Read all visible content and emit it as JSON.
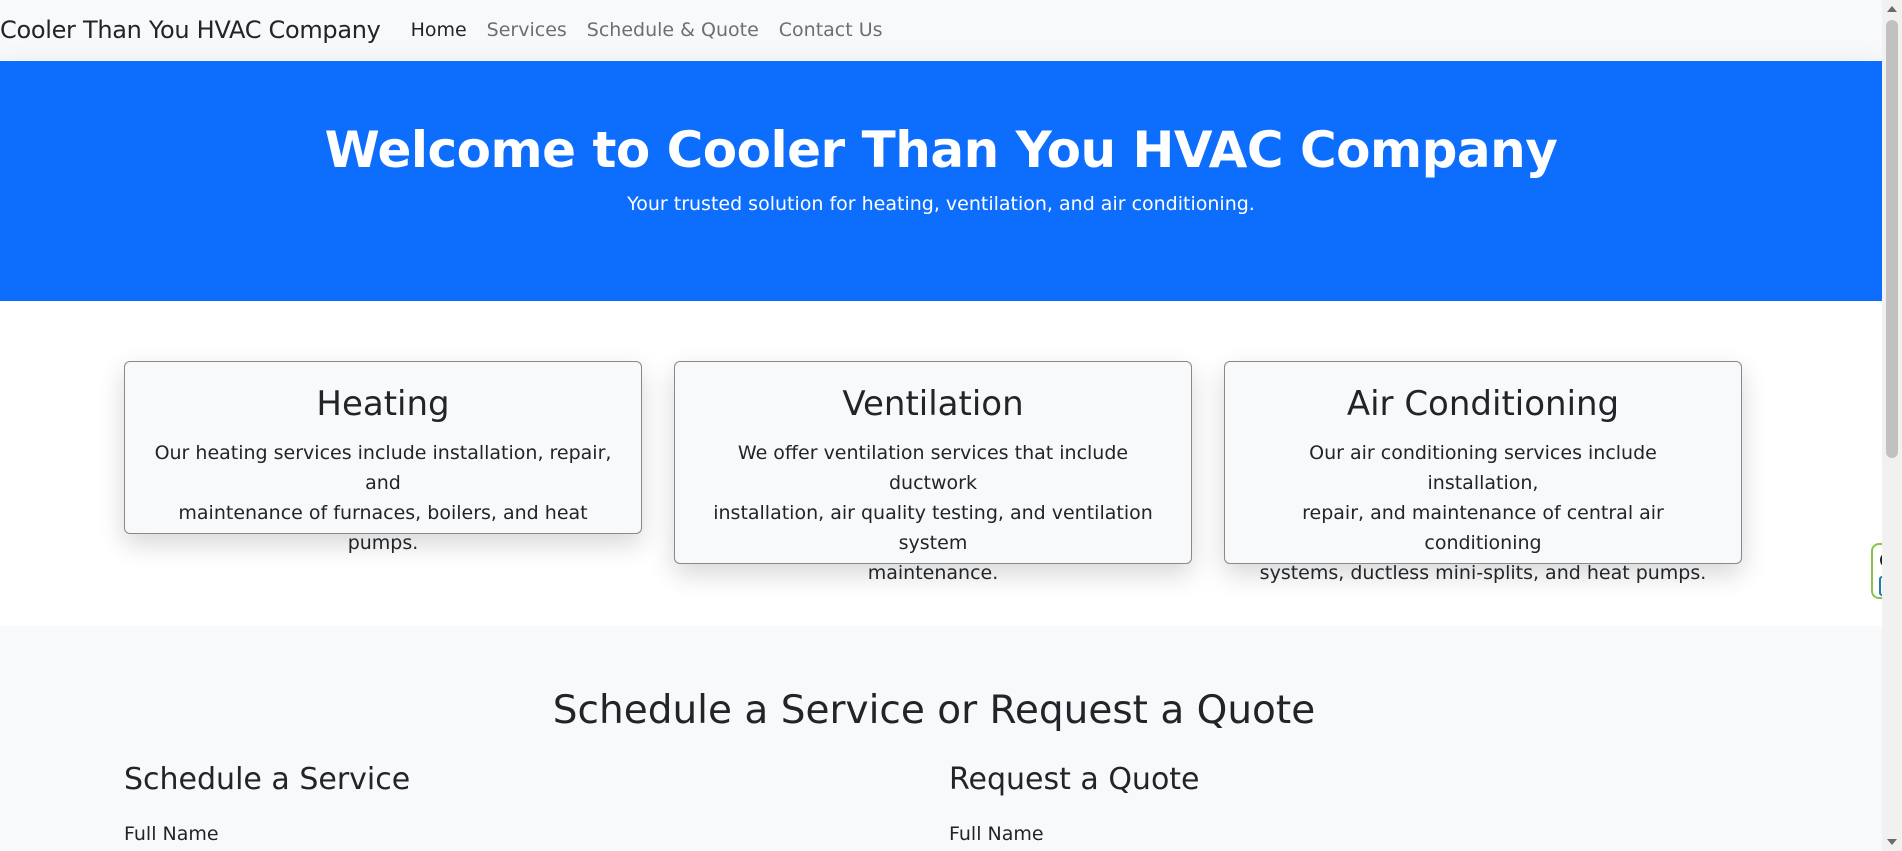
{
  "navbar": {
    "brand": "Cooler Than You HVAC Company",
    "links": [
      {
        "label": "Home",
        "active": true
      },
      {
        "label": "Services",
        "active": false
      },
      {
        "label": "Schedule & Quote",
        "active": false
      },
      {
        "label": "Contact Us",
        "active": false
      }
    ]
  },
  "hero": {
    "title": "Welcome to Cooler Than You HVAC Company",
    "subtitle": "Your trusted solution for heating, ventilation, and air conditioning.",
    "background_color": "#0d6efd"
  },
  "services": [
    {
      "title": "Heating",
      "description_lines": [
        "Our heating services include installation, repair, and",
        "maintenance of furnaces, boilers, and heat pumps."
      ]
    },
    {
      "title": "Ventilation",
      "description_lines": [
        "We offer ventilation services that include ductwork",
        "installation, air quality testing, and ventilation system",
        "maintenance."
      ]
    },
    {
      "title": "Air Conditioning",
      "description_lines": [
        "Our air conditioning services include installation,",
        "repair, and maintenance of central air conditioning",
        "systems, ductless mini-splits, and heat pumps."
      ]
    }
  ],
  "schedule": {
    "heading": "Schedule a Service or Request a Quote",
    "left": {
      "title": "Schedule a Service",
      "field_label": "Full Name"
    },
    "right": {
      "title": "Request a Quote",
      "field_label": "Full Name"
    }
  },
  "side_widget": {
    "icons": [
      "close-circle-icon",
      "e-letter-icon"
    ],
    "close_glyph": "✕",
    "e_glyph": "e",
    "accent_color": "#8bc34a"
  }
}
